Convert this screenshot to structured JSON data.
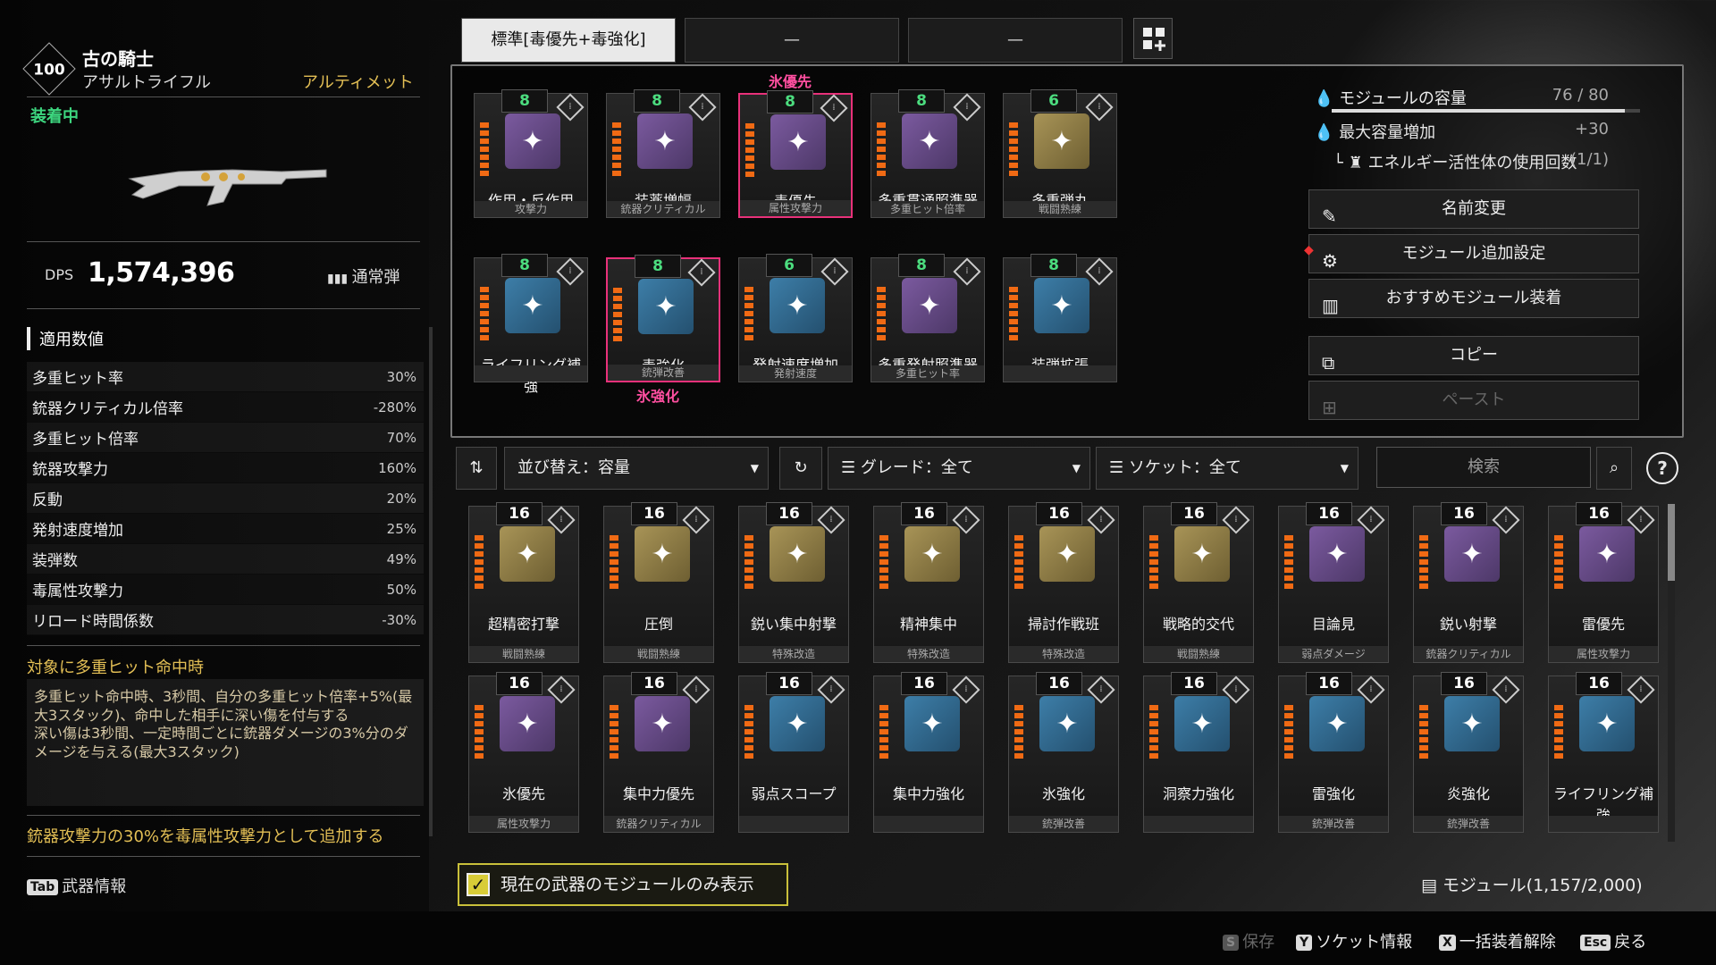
{
  "weapon": {
    "level": "100",
    "name": "古の騎士",
    "type": "アサルトライフル",
    "rarity": "アルティメット",
    "status": "装着中",
    "dps_label": "DPS",
    "dps_value": "1,574,396",
    "ammo_label": "通常弾"
  },
  "stats": {
    "section_title": "適用数値",
    "rows": [
      {
        "label": "多重ヒット率",
        "value": "30%"
      },
      {
        "label": "銃器クリティカル倍率",
        "value": "-280%"
      },
      {
        "label": "多重ヒット倍率",
        "value": "70%"
      },
      {
        "label": "銃器攻撃力",
        "value": "160%"
      },
      {
        "label": "反動",
        "value": "20%"
      },
      {
        "label": "発射速度増加",
        "value": "25%"
      },
      {
        "label": "装弾数",
        "value": "49%"
      },
      {
        "label": "毒属性攻撃力",
        "value": "50%"
      },
      {
        "label": "リロード時間係数",
        "value": "-30%"
      }
    ]
  },
  "effect": {
    "title": "対象に多重ヒット命中時",
    "text": "多重ヒット命中時、3秒間、自分の多重ヒット倍率+5%(最大3スタック)、命中した相手に深い傷を付与する\n深い傷は3秒間、一定時間ごとに銃器ダメージの3%分のダメージを与える(最大3スタック)",
    "extra": "銃器攻撃力の30%を毒属性攻撃力として追加する"
  },
  "tabinfo": {
    "key": "Tab",
    "label": "武器情報"
  },
  "tabs": {
    "t1": "標準[毒優先+毒強化]",
    "t2": "—",
    "t3": "—"
  },
  "equipped_modules": [
    {
      "cap": "8",
      "name": "作用・反作用",
      "cat": "攻撃力",
      "color": "iv"
    },
    {
      "cap": "8",
      "name": "装薬増幅",
      "cat": "銃器クリティカル",
      "color": "iv"
    },
    {
      "cap": "8",
      "name": "毒優先",
      "cat": "属性攻撃力",
      "color": "iv",
      "tag": "氷優先"
    },
    {
      "cap": "8",
      "name": "多重貫通照準器",
      "cat": "多重ヒット倍率",
      "color": "iv"
    },
    {
      "cap": "6",
      "name": "多重弾丸",
      "cat": "戦闘熟練",
      "color": "iy"
    },
    {
      "cap": "8",
      "name": "ライフリング補強",
      "cat": "",
      "color": "ib"
    },
    {
      "cap": "8",
      "name": "毒強化",
      "cat": "銃弾改善",
      "color": "ib",
      "tag": "氷強化"
    },
    {
      "cap": "6",
      "name": "発射速度増加",
      "cat": "発射速度",
      "color": "ib"
    },
    {
      "cap": "8",
      "name": "多重発射照準器",
      "cat": "多重ヒット率",
      "color": "iv"
    },
    {
      "cap": "8",
      "name": "装弾拡張",
      "cat": "",
      "color": "ib"
    }
  ],
  "capacity": {
    "label": "モジュールの容量",
    "value": "76 / 80",
    "max_label": "最大容量増加",
    "max_value": "+30",
    "energy_label": "エネルギー活性体の使用回数",
    "energy_value": "(1/1)"
  },
  "actions": {
    "rename": "名前変更",
    "addset": "モジュール追加設定",
    "recommend": "おすすめモジュール装着",
    "copy": "コピー",
    "paste": "ペースト"
  },
  "toolbar": {
    "sort": "並び替え：容量",
    "grade": "グレード：全て",
    "socket": "ソケット：全て",
    "search": "検索"
  },
  "inventory": [
    {
      "cap": "16",
      "name": "超精密打撃",
      "cat": "戦闘熟練",
      "color": "iy"
    },
    {
      "cap": "16",
      "name": "圧倒",
      "cat": "戦闘熟練",
      "color": "iy"
    },
    {
      "cap": "16",
      "name": "鋭い集中射撃",
      "cat": "特殊改造",
      "color": "iy"
    },
    {
      "cap": "16",
      "name": "精神集中",
      "cat": "特殊改造",
      "color": "iy"
    },
    {
      "cap": "16",
      "name": "掃討作戦班",
      "cat": "特殊改造",
      "color": "iy"
    },
    {
      "cap": "16",
      "name": "戦略的交代",
      "cat": "戦闘熟練",
      "color": "iy"
    },
    {
      "cap": "16",
      "name": "目論見",
      "cat": "弱点ダメージ",
      "color": "iv"
    },
    {
      "cap": "16",
      "name": "鋭い射撃",
      "cat": "銃器クリティカル",
      "color": "iv"
    },
    {
      "cap": "16",
      "name": "雷優先",
      "cat": "属性攻撃力",
      "color": "iv"
    },
    {
      "cap": "16",
      "name": "氷優先",
      "cat": "属性攻撃力",
      "color": "iv"
    },
    {
      "cap": "16",
      "name": "集中力優先",
      "cat": "銃器クリティカル",
      "color": "iv"
    },
    {
      "cap": "16",
      "name": "弱点スコープ",
      "cat": "",
      "color": "ib"
    },
    {
      "cap": "16",
      "name": "集中力強化",
      "cat": "",
      "color": "ib"
    },
    {
      "cap": "16",
      "name": "氷強化",
      "cat": "銃弾改善",
      "color": "ib"
    },
    {
      "cap": "16",
      "name": "洞察力強化",
      "cat": "",
      "color": "ib"
    },
    {
      "cap": "16",
      "name": "雷強化",
      "cat": "銃弾改善",
      "color": "ib"
    },
    {
      "cap": "16",
      "name": "炎強化",
      "cat": "銃弾改善",
      "color": "ib"
    },
    {
      "cap": "16",
      "name": "ライフリング補強",
      "cat": "",
      "color": "ib"
    }
  ],
  "filter": {
    "checkbox_label": "現在の武器のモジュールのみ表示"
  },
  "module_count": "モジュール(1,157/2,000)",
  "footer": {
    "save_key": "S",
    "save": "保存",
    "socket_key": "Y",
    "socket": "ソケット情報",
    "unequip_key": "X",
    "unequip": "一括装着解除",
    "back_key": "Esc",
    "back": "戻る"
  }
}
